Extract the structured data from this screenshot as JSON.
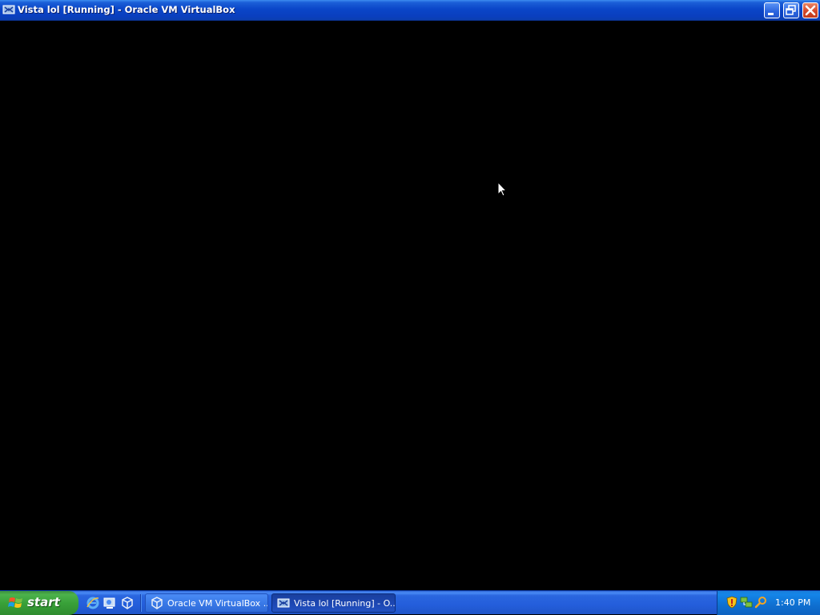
{
  "window": {
    "title": "Vista lol [Running] - Oracle VM VirtualBox",
    "icon": "virtualbox-vm-icon",
    "controls": [
      "minimize",
      "restore",
      "close"
    ]
  },
  "vm_screen": {
    "background": "#000000"
  },
  "taskbar": {
    "start_label": "start",
    "quick_launch": [
      "internet-explorer-icon",
      "show-desktop-icon",
      "virtualbox-icon"
    ],
    "tasks": [
      {
        "label": "Oracle VM VirtualBox ...",
        "icon": "virtualbox-icon",
        "active": false
      },
      {
        "label": "Vista lol [Running] - O...",
        "icon": "virtualbox-vm-icon",
        "active": true
      }
    ],
    "tray_icons": [
      "security-shield-icon",
      "network-icon",
      "search-icon"
    ],
    "clock": "1:40 PM"
  },
  "colors": {
    "titlebar_blue": "#0a46c8",
    "taskbar_blue": "#245edb",
    "start_green": "#39a139",
    "close_red": "#d5482a"
  }
}
